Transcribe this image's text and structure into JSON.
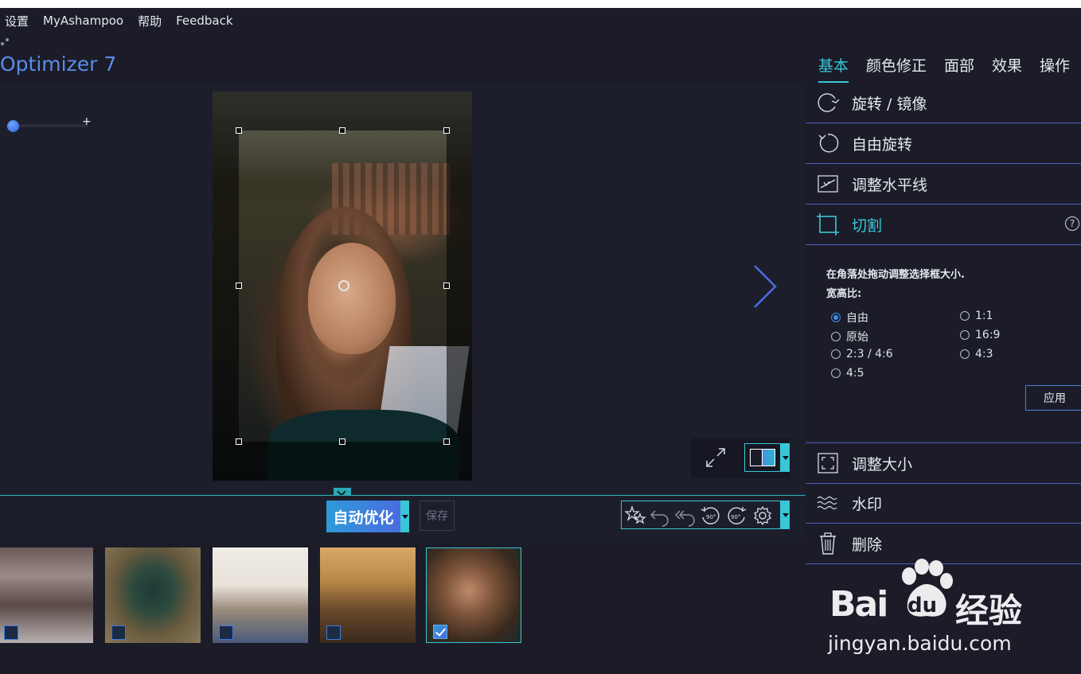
{
  "menu": {
    "settings": "设置",
    "myashampoo": "MyAshampoo",
    "help": "帮助",
    "feedback": "Feedback"
  },
  "app": {
    "title": "Optimizer 7"
  },
  "tabs": [
    {
      "label": "基本",
      "active": true
    },
    {
      "label": "颜色修正",
      "active": false
    },
    {
      "label": "面部",
      "active": false
    },
    {
      "label": "效果",
      "active": false
    },
    {
      "label": "操作",
      "active": false
    }
  ],
  "zoom": {
    "plus": "+",
    "level": 0.05
  },
  "sections": {
    "rotate_mirror": "旋转 / 镜像",
    "free_rotate": "自由旋转",
    "horizon": "调整水平线",
    "crop": "切割",
    "resize": "调整大小",
    "watermark": "水印",
    "delete": "删除"
  },
  "crop_panel": {
    "hint": "在角落处拖动调整选择框大小.",
    "ratio_label": "宽高比:",
    "help": "?",
    "options": [
      {
        "label": "自由",
        "checked": true
      },
      {
        "label": "1:1",
        "checked": false
      },
      {
        "label": "原始",
        "checked": false
      },
      {
        "label": "16:9",
        "checked": false
      },
      {
        "label": "2:3 / 4:6",
        "checked": false
      },
      {
        "label": "4:3",
        "checked": false
      },
      {
        "label": "4:5",
        "checked": false
      }
    ],
    "apply": "应用"
  },
  "toolbar": {
    "auto_optimize": "自动优化",
    "save": "保存",
    "rotate_left_90": "90°",
    "rotate_right_90": "90°"
  },
  "thumbnails": [
    {
      "selected": false
    },
    {
      "selected": false
    },
    {
      "selected": false
    },
    {
      "selected": false
    },
    {
      "selected": true
    }
  ],
  "watermark_logo": {
    "bai": "Bai",
    "du": "du",
    "jingyan": "经验",
    "url": "jingyan.baidu.com"
  },
  "colors": {
    "accent": "#39c6d6",
    "brand_blue": "#4a6ce0",
    "panel": "#1b1c28"
  }
}
